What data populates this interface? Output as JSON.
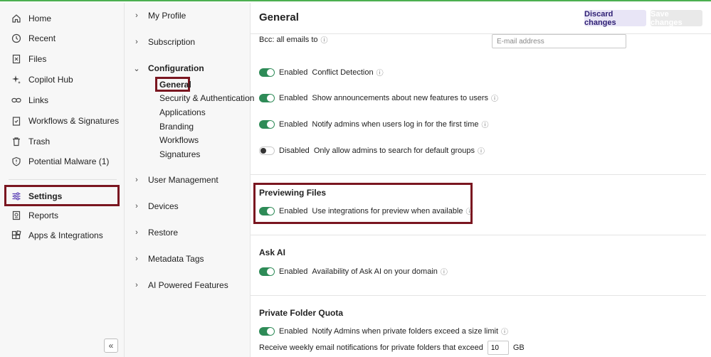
{
  "nav": {
    "items": [
      {
        "label": "Home",
        "icon": "home-icon"
      },
      {
        "label": "Recent",
        "icon": "clock-icon"
      },
      {
        "label": "Files",
        "icon": "file-icon"
      },
      {
        "label": "Copilot Hub",
        "icon": "sparkle-icon"
      },
      {
        "label": "Links",
        "icon": "link-icon"
      },
      {
        "label": "Workflows & Signatures",
        "icon": "clipboard-check-icon"
      },
      {
        "label": "Trash",
        "icon": "trash-icon"
      },
      {
        "label": "Potential Malware (1)",
        "icon": "shield-icon"
      },
      {
        "label": "Settings",
        "icon": "sliders-icon"
      },
      {
        "label": "Reports",
        "icon": "report-icon"
      },
      {
        "label": "Apps & Integrations",
        "icon": "apps-icon"
      }
    ],
    "collapse_glyph": "«"
  },
  "tree": {
    "items": [
      {
        "label": "My Profile",
        "chevron": "›"
      },
      {
        "label": "Subscription",
        "chevron": "›"
      },
      {
        "label": "Configuration",
        "chevron": "⌄"
      },
      {
        "label": "User Management",
        "chevron": "›"
      },
      {
        "label": "Devices",
        "chevron": "›"
      },
      {
        "label": "Restore",
        "chevron": "›"
      },
      {
        "label": "Metadata Tags",
        "chevron": "›"
      },
      {
        "label": "AI Powered Features",
        "chevron": "›"
      }
    ],
    "sub_items": [
      "General",
      "Security & Authentication",
      "Applications",
      "Branding",
      "Workflows",
      "Signatures"
    ]
  },
  "main": {
    "title": "General",
    "discard_label": "Discard changes",
    "save_label": "Save changes",
    "bcc_label": "Bcc: all emails to",
    "email_placeholder": "E-mail address",
    "info_glyph": "ⓘ",
    "settings": [
      {
        "state": "Enabled",
        "label": "Conflict Detection"
      },
      {
        "state": "Enabled",
        "label": "Show announcements about new features to users"
      },
      {
        "state": "Enabled",
        "label": "Notify admins when users log in for the first time"
      },
      {
        "state": "Disabled",
        "label": "Only allow admins to search for default groups"
      }
    ],
    "previewing": {
      "title": "Previewing Files",
      "state": "Enabled",
      "label": "Use integrations for preview when available"
    },
    "ask_ai": {
      "title": "Ask AI",
      "state": "Enabled",
      "label": "Availability of Ask AI on your domain"
    },
    "quota": {
      "title": "Private Folder Quota",
      "state": "Enabled",
      "label": "Notify Admins when private folders exceed a size limit",
      "threshold_prefix": "Receive weekly email notifications for private folders that exceed",
      "threshold_value": "10",
      "threshold_unit": "GB"
    }
  },
  "colors": {
    "accent_green": "#2e8b57",
    "highlight_border": "#7a1620",
    "discard_bg": "#e8e5f6"
  }
}
